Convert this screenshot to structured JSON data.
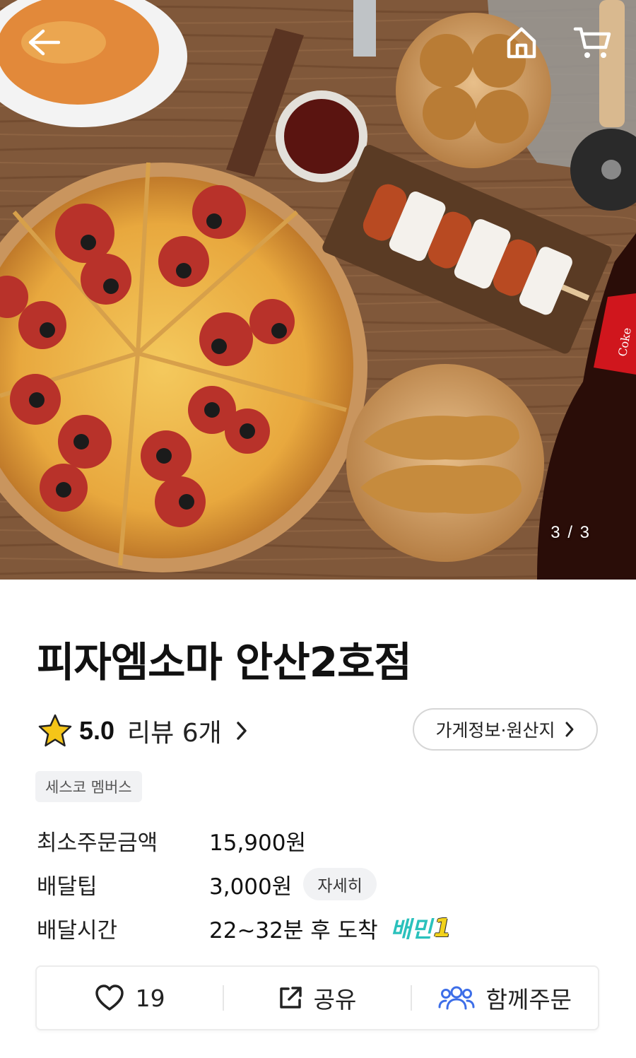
{
  "header": {
    "back_icon": "back-arrow-icon",
    "home_icon": "home-icon",
    "cart_icon": "cart-icon",
    "pager": "3 / 3"
  },
  "store": {
    "name": "피자엠소마 안산2호점",
    "rating": "5.0",
    "review_label": "리뷰 6개",
    "info_button": "가게정보·원산지",
    "badge": "세스코 멤버스"
  },
  "details": {
    "min_order_label": "최소주문금액",
    "min_order_value": "15,900원",
    "tip_label": "배달팁",
    "tip_value": "3,000원",
    "tip_detail_button": "자세히",
    "time_label": "배달시간",
    "time_value": "22~32분 후 도착",
    "baemin_text": "배민",
    "baemin_number": "1"
  },
  "actions": {
    "like_count": "19",
    "share_label": "공유",
    "group_order_label": "함께주문"
  },
  "colors": {
    "accent": "#2ac1bc",
    "group_icon": "#3d6ee8",
    "star": "#f5c518"
  }
}
